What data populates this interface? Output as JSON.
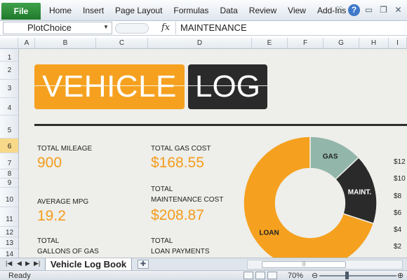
{
  "ribbon": {
    "file_label": "File",
    "tabs": [
      "Home",
      "Insert",
      "Page Layout",
      "Formulas",
      "Data",
      "Review",
      "View",
      "Add-Ins"
    ],
    "icons": [
      "chevron-heart-icon",
      "help-icon",
      "minimize-icon",
      "restore-icon",
      "close-icon"
    ]
  },
  "formula_bar": {
    "name_box": "PlotChoice",
    "fx": "fx",
    "value": "MAINTENANCE"
  },
  "columns": [
    "A",
    "B",
    "C",
    "D",
    "E",
    "F",
    "G",
    "H",
    "I"
  ],
  "rows": [
    "1",
    "2",
    "3",
    "4",
    "5",
    "6",
    "7",
    "8",
    "9",
    "10",
    "11",
    "12",
    "13",
    "14"
  ],
  "selected_row": "6",
  "title": {
    "left": "VEHICLE",
    "right": "LOG"
  },
  "stats": {
    "total_mileage_label": "TOTAL MILEAGE",
    "total_mileage_value": "900",
    "avg_mpg_label": "AVERAGE MPG",
    "avg_mpg_value": "19.2",
    "total_gallons_label_1": "TOTAL",
    "total_gallons_label_2": "GALLONS OF GAS",
    "total_gas_cost_label": "TOTAL GAS COST",
    "total_gas_cost_value": "$168.55",
    "total_maint_label_1": "TOTAL",
    "total_maint_label_2": "MAINTENANCE COST",
    "total_maint_value": "$208.87",
    "total_loan_label_1": "TOTAL",
    "total_loan_label_2": "LOAN PAYMENTS"
  },
  "side_numbers": [
    "$12",
    "$10",
    "$8",
    "$6",
    "$4",
    "$2"
  ],
  "chart_data": {
    "type": "pie",
    "categories": [
      "GAS",
      "MAINT.",
      "LOAN"
    ],
    "values": [
      13,
      17,
      70
    ],
    "colors": [
      "#92b7aa",
      "#2a2a2a",
      "#f5a11f"
    ],
    "hole": 0.52
  },
  "sheet_tab": {
    "label": "Vehicle Log Book"
  },
  "status": {
    "ready": "Ready",
    "zoom": "70%"
  }
}
